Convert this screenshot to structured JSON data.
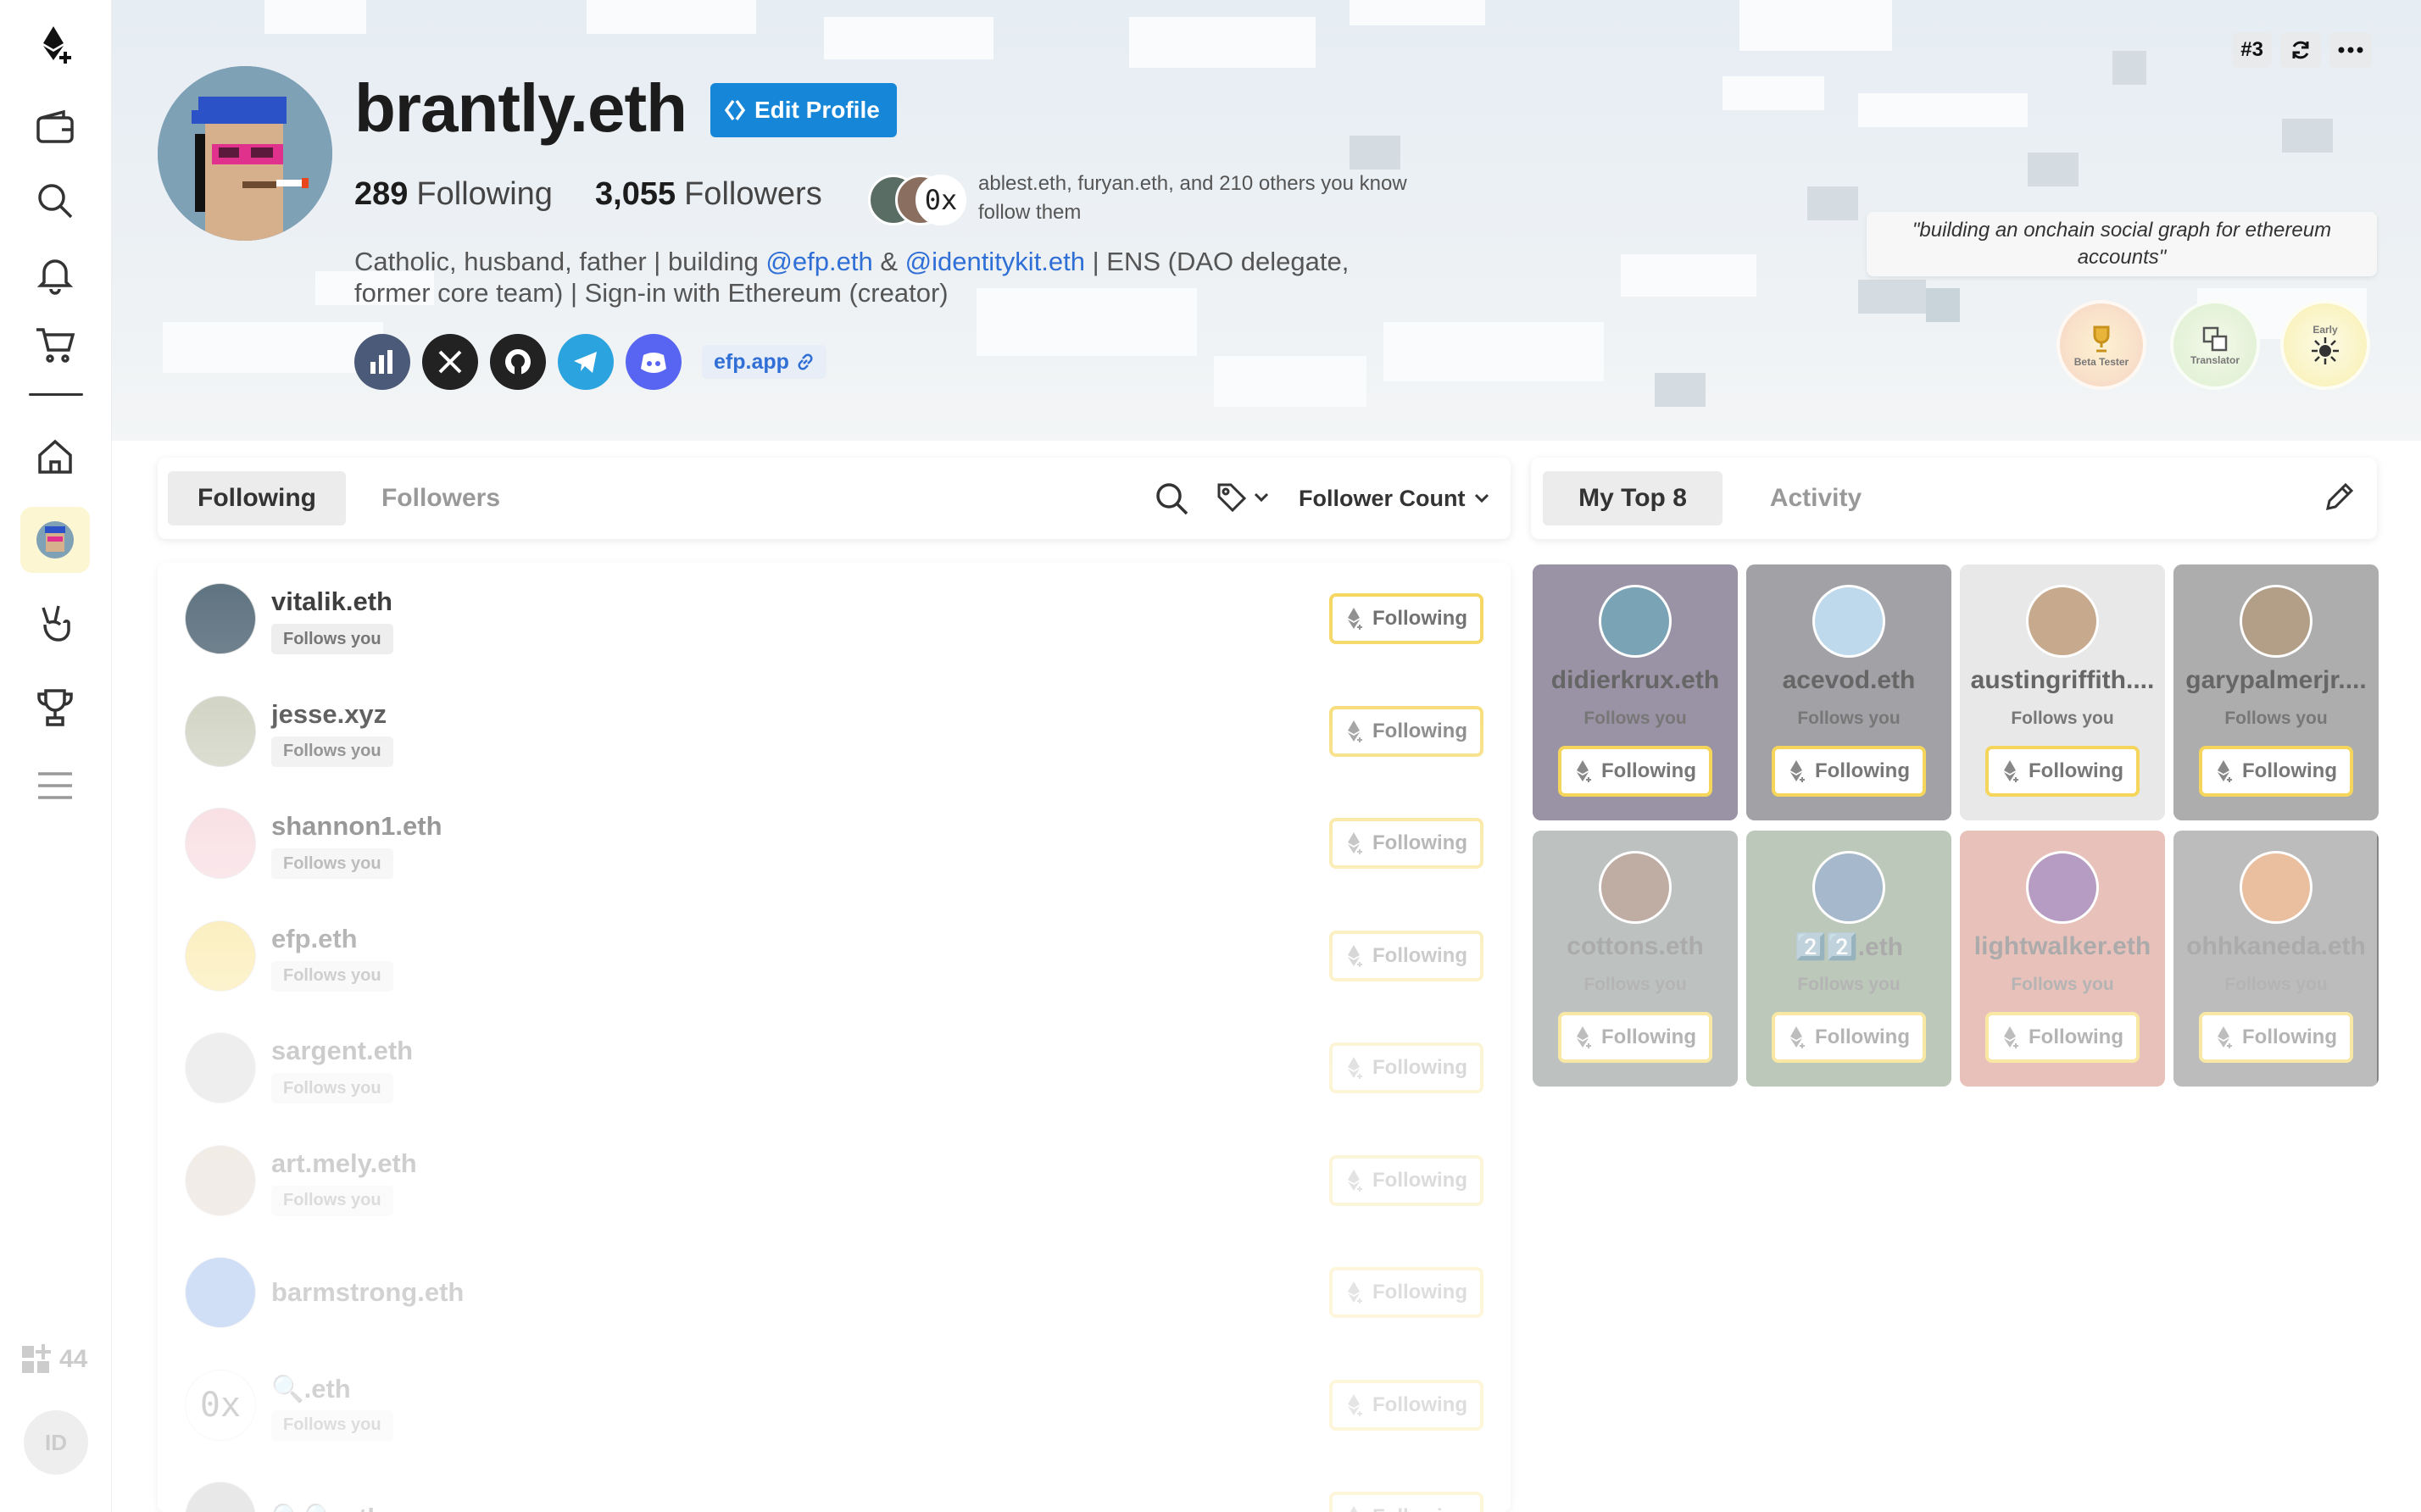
{
  "profile": {
    "name": "brantly.eth",
    "edit_label": "Edit Profile",
    "following_count": "289",
    "following_label": "Following",
    "followers_count": "3,055",
    "followers_label": "Followers",
    "mutual_avatar_text": "0x",
    "mutual_line1": "ablest.eth, furyan.eth, and 210 others you know",
    "mutual_line2": "follow them",
    "bio_part1": "Catholic, husband, father | building ",
    "bio_link1": "@efp.eth",
    "bio_part2": " & ",
    "bio_link2": "@identitykit.eth",
    "bio_part3": " | ENS (DAO delegate, former core team) | Sign-in with Ethereum (creator)",
    "website": "efp.app",
    "rank": "#3",
    "quote": "\"building an onchain social graph for ethereum accounts\"",
    "badges": [
      "Beta Tester",
      "Translator",
      "Early"
    ]
  },
  "sidebar": {
    "footer_count": "44",
    "id_label": "ID",
    "icons": [
      "efp-logo-icon",
      "wallet-icon",
      "search-icon",
      "bell-icon",
      "cart-icon",
      "home-icon",
      "profile-avatar",
      "peace-hand-icon",
      "trophy-icon",
      "menu-icon"
    ]
  },
  "list_panel": {
    "tabs": [
      "Following",
      "Followers"
    ],
    "sort_label": "Follower Count",
    "follows_you": "Follows you",
    "button_label": "Following",
    "rows": [
      {
        "name": "vitalik.eth",
        "follows_you": true,
        "color": "#5b6f7d"
      },
      {
        "name": "jesse.xyz",
        "follows_you": true,
        "color": "#c8ccb8"
      },
      {
        "name": "shannon1.eth",
        "follows_you": true,
        "color": "#f3c6cf"
      },
      {
        "name": "efp.eth",
        "follows_you": true,
        "color": "#f5d55a"
      },
      {
        "name": "sargent.eth",
        "follows_you": true,
        "color": "#bbbbbb"
      },
      {
        "name": "art.mely.eth",
        "follows_you": true,
        "color": "#c9b09c"
      },
      {
        "name": "barmstrong.eth",
        "follows_you": false,
        "color": "#2f6fd6"
      },
      {
        "name": "🔍.eth",
        "follows_you": true,
        "color": "#ffffff",
        "avatar_text": "0x"
      },
      {
        "name": "🔍🔍.eth",
        "follows_you": false,
        "color": "#999999"
      }
    ]
  },
  "top8_panel": {
    "tabs": [
      "My Top 8",
      "Activity"
    ],
    "follows_you": "Follows you",
    "button_label": "Following",
    "cards": [
      {
        "name": "didierkrux.eth",
        "bg": "#5c4f6e",
        "av": "#7aa4b5"
      },
      {
        "name": "acevod.eth",
        "bg": "#6a6a70",
        "av": "#bfd9ec"
      },
      {
        "name": "austingriffith....",
        "bg": "#dadada",
        "av": "#c7a98d"
      },
      {
        "name": "garypalmerjr....",
        "bg": "#7b7b7b",
        "av": "#b39f87"
      },
      {
        "name": "cottons.eth",
        "bg": "#3f4d46",
        "av": "#8a6a58"
      },
      {
        "name": "2️⃣2️⃣.eth",
        "bg": "#3b5e32",
        "av": "#5d7fa1"
      },
      {
        "name": "lightwalker.eth",
        "bg": "#c04a38",
        "av": "#7a4c90"
      },
      {
        "name": "ohhkaneda.eth",
        "bg": "#3b3b3b",
        "av": "#d98a52"
      }
    ]
  }
}
